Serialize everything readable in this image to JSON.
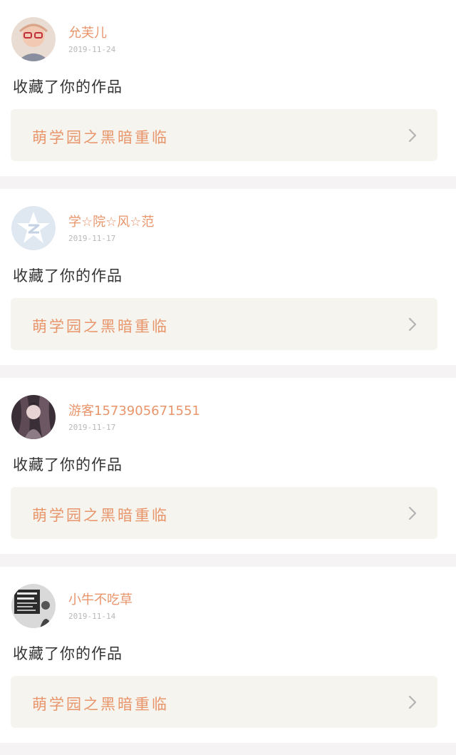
{
  "notifications": [
    {
      "username": "允芙儿",
      "date": "2019-11-24",
      "action": "收藏了你的作品",
      "work_title": "萌学园之黑暗重临",
      "avatar_icon": "child-photo-avatar-icon"
    },
    {
      "username": "学☆院☆风☆范",
      "date": "2019-11-17",
      "action": "收藏了你的作品",
      "work_title": "萌学园之黑暗重临",
      "avatar_icon": "qq-default-avatar-icon"
    },
    {
      "username": "游客1573905671551",
      "date": "2019-11-17",
      "action": "收藏了你的作品",
      "work_title": "萌学园之黑暗重临",
      "avatar_icon": "anime-character-avatar-icon"
    },
    {
      "username": "小牛不吃草",
      "date": "2019-11-14",
      "action": "收藏了你的作品",
      "work_title": "萌学园之黑暗重临",
      "avatar_icon": "text-poster-avatar-icon"
    }
  ],
  "colors": {
    "accent": "#e8956b",
    "link_bg": "#f5f4ee",
    "page_bg": "#f5f3f3",
    "date": "#b8b8b8"
  },
  "icons": {
    "chevron": "chevron-right-icon"
  }
}
